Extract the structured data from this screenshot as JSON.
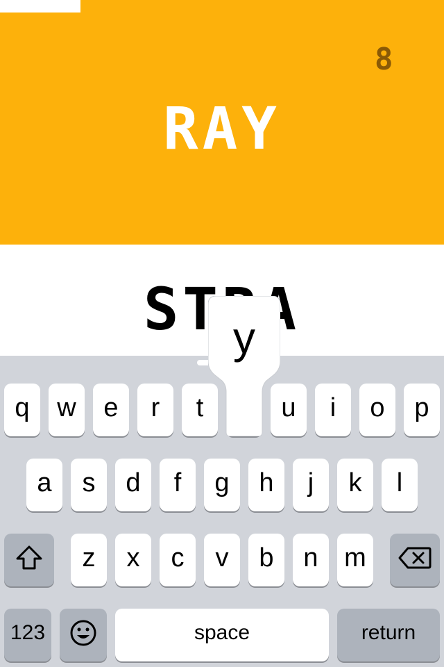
{
  "game": {
    "score": "8",
    "target_word": "RAY",
    "typed_word": "STRA"
  },
  "keyboard": {
    "row1": [
      "q",
      "w",
      "e",
      "r",
      "t",
      "y",
      "u",
      "i",
      "o",
      "p"
    ],
    "row2": [
      "a",
      "s",
      "d",
      "f",
      "g",
      "h",
      "j",
      "k",
      "l"
    ],
    "row3": [
      "z",
      "x",
      "c",
      "v",
      "b",
      "n",
      "m"
    ],
    "numbers_label": "123",
    "space_label": "space",
    "return_label": "return",
    "pressed_key": "y"
  },
  "colors": {
    "top_background": "#FDB10B",
    "score_color": "#8A5A06",
    "keyboard_background": "#D1D4DA",
    "special_key": "#ADB3BC"
  },
  "icons": {
    "shift": "shift-icon",
    "delete": "backspace-icon",
    "emoji": "emoji-icon"
  }
}
